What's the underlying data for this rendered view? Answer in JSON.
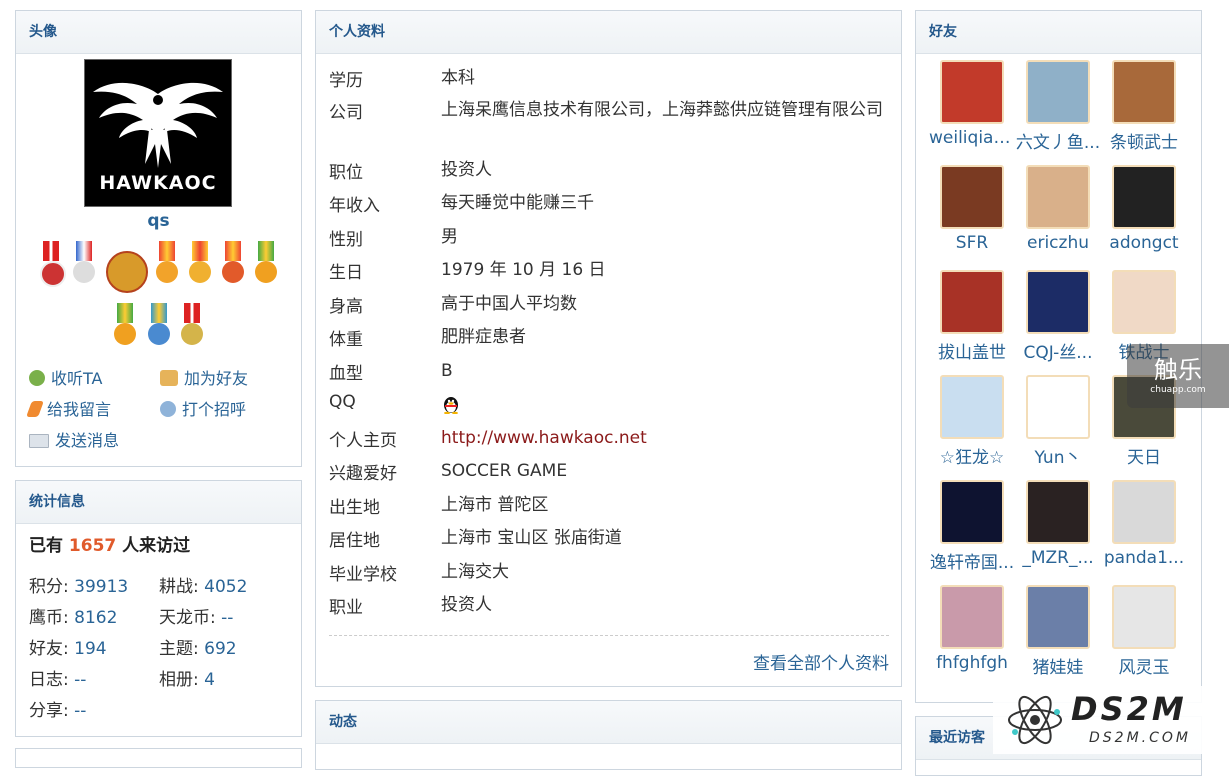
{
  "avatar_panel": {
    "title": "头像",
    "logo_text": "HawKaoc",
    "username": "qs",
    "actions": {
      "follow": "收听TA",
      "add_friend": "加为好友",
      "leave_message": "给我留言",
      "greet": "打个招呼",
      "send_message": "发送消息"
    }
  },
  "stats_panel": {
    "title": "统计信息",
    "visits_prefix": "已有",
    "visits_count": "1657",
    "visits_suffix": "人来访过",
    "items": [
      {
        "label": "积分: ",
        "value": "39913"
      },
      {
        "label": "耕战: ",
        "value": "4052"
      },
      {
        "label": "鹰币: ",
        "value": "8162"
      },
      {
        "label": "天龙币: ",
        "value": "--"
      },
      {
        "label": "好友: ",
        "value": "194"
      },
      {
        "label": "主题: ",
        "value": "692"
      },
      {
        "label": "日志: ",
        "value": "--"
      },
      {
        "label": "相册: ",
        "value": "4"
      },
      {
        "label": "分享: ",
        "value": "--"
      }
    ]
  },
  "profile_panel": {
    "title": "个人资料",
    "rows": [
      {
        "label": "学历",
        "value": "本科"
      },
      {
        "label": "公司",
        "value": "上海呆鹰信息技术有限公司，上海莽懿供应链管理有限公司"
      },
      {
        "label": "职位",
        "value": "投资人"
      },
      {
        "label": "年收入",
        "value": "每天睡觉中能赚三千"
      },
      {
        "label": "性别",
        "value": "男"
      },
      {
        "label": "生日",
        "value": "1979 年 10 月 16 日"
      },
      {
        "label": "身高",
        "value": "高于中国人平均数"
      },
      {
        "label": "体重",
        "value": "肥胖症患者"
      },
      {
        "label": "血型",
        "value": "B"
      },
      {
        "label": "QQ",
        "value": ""
      },
      {
        "label": "个人主页",
        "value": "http://www.hawkaoc.net"
      },
      {
        "label": "兴趣爱好",
        "value": "SOCCER GAME"
      },
      {
        "label": "出生地",
        "value": "上海市 普陀区"
      },
      {
        "label": "居住地",
        "value": "上海市 宝山区 张庙街道"
      },
      {
        "label": "毕业学校",
        "value": "上海交大"
      },
      {
        "label": "职业",
        "value": "投资人"
      }
    ],
    "view_all": "查看全部个人资料"
  },
  "feed_panel": {
    "title": "动态"
  },
  "friends_panel": {
    "title": "好友",
    "friends": [
      {
        "name": "weiliqiang",
        "color": "#c23a2a"
      },
      {
        "name": "六文丿鱼...",
        "color": "#8fb0c8"
      },
      {
        "name": "条顿武士",
        "color": "#a8693a"
      },
      {
        "name": "SFR",
        "color": "#7a3a22"
      },
      {
        "name": "ericzhu",
        "color": "#d9b08a"
      },
      {
        "name": "adongct",
        "color": "#222222"
      },
      {
        "name": "拔山盖世",
        "color": "#a83226"
      },
      {
        "name": "CQJ-丝...",
        "color": "#1c2c66"
      },
      {
        "name": "铁战士",
        "color": "#f0d9c6"
      },
      {
        "name": "☆狂龙☆",
        "color": "#c9def0"
      },
      {
        "name": "Yun丶",
        "color": "#ffffff"
      },
      {
        "name": "天日",
        "color": "#4a4a3a"
      },
      {
        "name": "逸轩帝国...",
        "color": "#0e1330"
      },
      {
        "name": "_MZR_...",
        "color": "#2a2222"
      },
      {
        "name": "panda1...",
        "color": "#d9d9d9"
      },
      {
        "name": "fhfghfgh",
        "color": "#c99aaa"
      },
      {
        "name": "猪娃娃",
        "color": "#6b7fa8"
      },
      {
        "name": "风灵玉",
        "color": "#e6e6e6"
      }
    ]
  },
  "visitors_panel": {
    "title": "最近访客"
  },
  "watermarks": {
    "chuapp_text": "触乐",
    "chuapp_sub": "chuapp.com",
    "ds2m_text": "DS2M",
    "ds2m_sub": "DS2M.COM"
  },
  "colors": {
    "link": "#2a6496",
    "visits_num": "#e05a2b",
    "header_text": "#24588c"
  }
}
